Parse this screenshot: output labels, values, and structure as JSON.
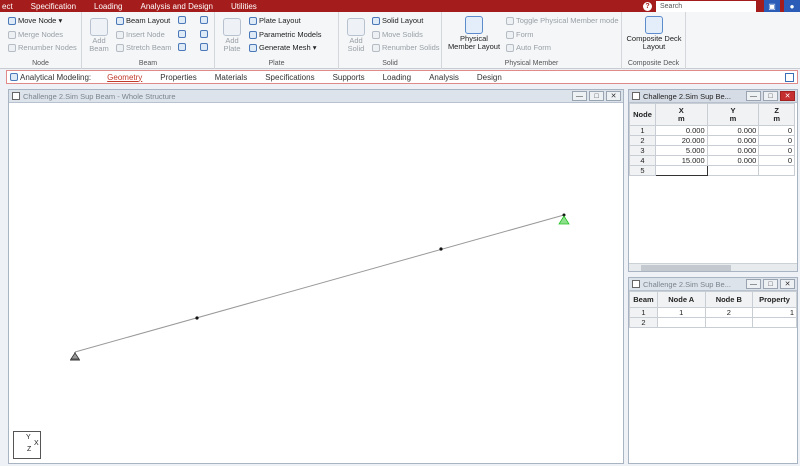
{
  "menu": {
    "items": [
      "ect",
      "Specification",
      "Loading",
      "Analysis and Design",
      "Utilities"
    ],
    "help": "?",
    "search_placeholder": "Search"
  },
  "ribbon": {
    "node": {
      "label": "Node",
      "move": "Move Node",
      "merge": "Merge Nodes",
      "renumber": "Renumber Nodes"
    },
    "beam": {
      "label": "Beam",
      "add_beam": "Add Beam",
      "layout": "Beam Layout",
      "insert": "Insert Node",
      "stretch": "Stretch Beam"
    },
    "plate": {
      "label": "Plate",
      "add_plate": "Add Plate",
      "layout": "Plate Layout",
      "parametric": "Parametric Models",
      "mesh": "Generate Mesh"
    },
    "solid": {
      "label": "Solid",
      "add_solid": "Add Solid",
      "layout": "Solid Layout",
      "move": "Move Solids",
      "renumber": "Renumber Solids"
    },
    "physical": {
      "label": "Physical Member",
      "layout_btn": "Physical Member Layout",
      "toggle": "Toggle Physical Member mode",
      "form": "Form",
      "auto_form": "Auto Form"
    },
    "composite": {
      "label": "Composite Deck",
      "layout_btn": "Composite Deck Layout"
    }
  },
  "workflow": {
    "label": "Analytical Modeling:",
    "tabs": [
      "Geometry",
      "Properties",
      "Materials",
      "Specifications",
      "Supports",
      "Loading",
      "Analysis",
      "Design"
    ],
    "active": "Geometry"
  },
  "main_window": {
    "title": "Challenge 2.Sim Sup Beam - Whole Structure",
    "axis_labels": [
      "Y",
      "Z",
      "X"
    ]
  },
  "node_table": {
    "title": "Challenge 2.Sim Sup Be...",
    "columns": [
      {
        "name": "Node",
        "unit": ""
      },
      {
        "name": "X",
        "unit": "m"
      },
      {
        "name": "Y",
        "unit": "m"
      },
      {
        "name": "Z",
        "unit": "m"
      }
    ],
    "rows": [
      [
        "1",
        "0.000",
        "0.000",
        "0"
      ],
      [
        "2",
        "20.000",
        "0.000",
        "0"
      ],
      [
        "3",
        "5.000",
        "0.000",
        "0"
      ],
      [
        "4",
        "15.000",
        "0.000",
        "0"
      ],
      [
        "5",
        "",
        "",
        ""
      ]
    ]
  },
  "beam_table": {
    "title": "Challenge 2.Sim Sup Be...",
    "columns": [
      "Beam",
      "Node A",
      "Node B",
      "Property"
    ],
    "rows": [
      [
        "1",
        "1",
        "2",
        "1"
      ],
      [
        "2",
        "",
        "",
        ""
      ]
    ]
  },
  "window_buttons": {
    "min": "—",
    "max": "□",
    "close": "✕"
  },
  "colors": {
    "menubar": "#a51c1c",
    "accent": "#2a5cb8",
    "support_fixed": "#22c022",
    "support_pinned": "#444444",
    "beam": "#999999"
  }
}
